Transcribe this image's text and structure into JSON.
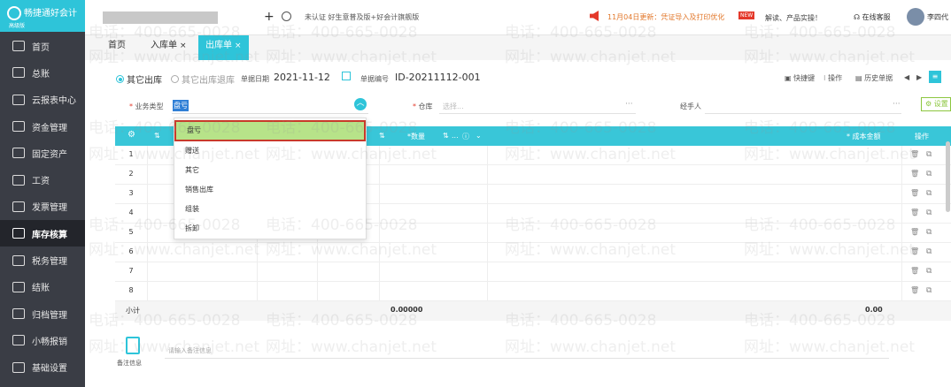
{
  "app": {
    "logo_text": "畅捷通好会计",
    "logo_sub": "高级版"
  },
  "sidebar": {
    "items": [
      {
        "label": "首页",
        "icon": "home-icon"
      },
      {
        "label": "总账",
        "icon": "ledger-icon"
      },
      {
        "label": "云报表中心",
        "icon": "chart-icon"
      },
      {
        "label": "资金管理",
        "icon": "money-icon"
      },
      {
        "label": "固定资产",
        "icon": "asset-icon"
      },
      {
        "label": "工资",
        "icon": "salary-icon"
      },
      {
        "label": "发票管理",
        "icon": "invoice-icon"
      },
      {
        "label": "库存核算",
        "icon": "inventory-icon",
        "active": true
      },
      {
        "label": "税务管理",
        "icon": "tax-icon"
      },
      {
        "label": "结账",
        "icon": "closing-icon"
      },
      {
        "label": "归档管理",
        "icon": "archive-icon"
      },
      {
        "label": "小畅报销",
        "icon": "reimburse-icon"
      },
      {
        "label": "基础设置",
        "icon": "settings-icon"
      }
    ]
  },
  "topbar": {
    "plus": "+",
    "cert_text": "未认证 好生意普及版+好会计旗舰版",
    "notice": "11月04日更新：凭证导入及打印优化",
    "new_tag": "NEW",
    "read_text": "解读、产品实操！",
    "service": "在线客服",
    "user": "李四代"
  },
  "tabs": [
    {
      "label": "首页",
      "closable": false
    },
    {
      "label": "入库单",
      "closable": true
    },
    {
      "label": "出库单",
      "closable": true,
      "active": true
    }
  ],
  "close_glyph": "×",
  "form": {
    "radio_out": "其它出库",
    "radio_return": "其它出库退库",
    "date_label": "单据日期",
    "date_value": "2021-11-12",
    "code_label": "单据编号",
    "code_value": "ID-20211112-001",
    "shortcut": "快捷键",
    "operate": "操作",
    "history": "历史单据",
    "biz_type_label": "业务类型",
    "biz_type_value": "盘亏",
    "warehouse_label": "仓库",
    "warehouse_placeholder": "选择...",
    "handler_label": "经手人",
    "settings_btn": "设置",
    "more": "···"
  },
  "table": {
    "headers": {
      "qty": "数量",
      "ellipsis": "...",
      "cost": "成本金额",
      "op": "操作"
    },
    "rows": [
      "1",
      "2",
      "3",
      "4",
      "5",
      "6",
      "7",
      "8"
    ],
    "subtotal_label": "小计",
    "subtotal_qty": "0.00000",
    "subtotal_cost": "0.00"
  },
  "dropdown": {
    "options": [
      "盘亏",
      "赠送",
      "其它",
      "销售出库",
      "组装",
      "拆卸"
    ],
    "selected": "盘亏"
  },
  "note": {
    "label": "备注信息",
    "placeholder": "请输入备注信息"
  },
  "watermark": {
    "phone": "电话：400-665-0028",
    "site": "网址：www.chanjet.net"
  }
}
